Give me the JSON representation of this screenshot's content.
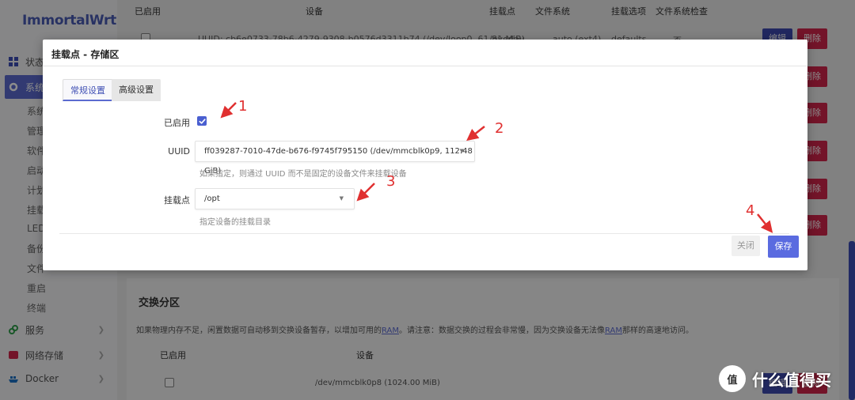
{
  "app": {
    "logo": "ImmortalWrt"
  },
  "sidebar": {
    "items": [
      {
        "label": "状态",
        "icon": "grid-icon"
      },
      {
        "label": "系统",
        "icon": "gear-icon"
      },
      {
        "label": "服务",
        "icon": "link-icon"
      },
      {
        "label": "网络存储",
        "icon": "disk-icon"
      },
      {
        "label": "Docker",
        "icon": "docker-icon"
      }
    ],
    "sub_items": [
      "系统",
      "管理",
      "软件",
      "启动",
      "计划",
      "挂载",
      "LED",
      "备份",
      "文件",
      "重启",
      "终端"
    ]
  },
  "bg_table": {
    "headers": [
      "已启用",
      "设备",
      "挂载点",
      "文件系统",
      "挂载选项",
      "文件系统检查"
    ],
    "row1": {
      "device": "UUID: cb6e0733-78b6-4279-9308-b0576d3311b74 (/dev/loop0, 61.81 MiB)",
      "mount": "/overlay",
      "fs": "auto (ext4)",
      "options": "defaults",
      "check": "否"
    },
    "edit_label": "编辑",
    "delete_label": "删除"
  },
  "swap": {
    "title": "交换分区",
    "desc_prefix": "如果物理内存不足，闲置数据可自动移到交换设备暂存，以增加可用的",
    "desc_link1": "RAM",
    "desc_mid": "。请注意：数据交换的过程会非常慢，因为交换设备无法像",
    "desc_link2": "RAM",
    "desc_suffix": "那样的高速地访问。",
    "headers": [
      "已启用",
      "设备"
    ],
    "row_device": "/dev/mmcblk0p8 (1024.00 MiB)"
  },
  "modal": {
    "title": "挂载点 - 存储区",
    "tabs": [
      {
        "label": "常规设置",
        "active": true
      },
      {
        "label": "高级设置",
        "active": false
      }
    ],
    "enabled_label": "已启用",
    "enabled": true,
    "uuid_label": "UUID",
    "uuid_value": "ff039287-7010-47de-b676-f9745f795150 (/dev/mmcblk0p9, 112.48 GiB)",
    "uuid_hint": "如果指定，则通过 UUID 而不是固定的设备文件来挂载设备",
    "mount_label": "挂载点",
    "mount_value": "/opt",
    "mount_hint": "指定设备的挂载目录",
    "close_label": "关闭",
    "save_label": "保存"
  },
  "annotations": [
    "1",
    "2",
    "3",
    "4"
  ],
  "watermark": {
    "text": "什么值得买",
    "badge": "值"
  },
  "colors": {
    "accent": "#5b6bd0",
    "danger": "#d2254b",
    "annotation": "#e03030"
  }
}
